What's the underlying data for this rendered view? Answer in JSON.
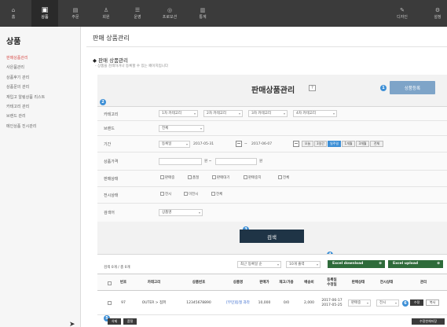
{
  "nav": {
    "left": [
      {
        "icon": "⌂",
        "label": "홈"
      },
      {
        "icon": "▣",
        "label": "상품"
      },
      {
        "icon": "▤",
        "label": "주문"
      },
      {
        "icon": "♙",
        "label": "회원"
      },
      {
        "icon": "☰",
        "label": "운영"
      },
      {
        "icon": "◎",
        "label": "프로모션"
      },
      {
        "icon": "▥",
        "label": "통계"
      }
    ],
    "right": [
      {
        "icon": "✎",
        "label": "디자인"
      },
      {
        "icon": "⚙",
        "label": "설정"
      }
    ]
  },
  "sidebar": {
    "title": "상품",
    "items": [
      {
        "label": "판매상품관리",
        "active": true
      },
      {
        "label": "사은품관리"
      },
      {
        "label": "상품후기 관리"
      },
      {
        "label": "상품문의 관리"
      },
      {
        "label": "재입고 알림상품 리스트"
      },
      {
        "label": "카테고리 관리"
      },
      {
        "label": "브랜드 관리"
      },
      {
        "label": "메인상품 진시관리"
      }
    ]
  },
  "page": {
    "title": "판매 상품관리",
    "section_title": "◆ 판매 상품관리",
    "section_sub": "- 상품을 검색하거나 등록할 수 있는 페이지입니다"
  },
  "panel": {
    "title": "판매상품관리",
    "title_icon": "?",
    "register_label": "상품등록",
    "badges": [
      "2",
      "1",
      "3",
      "4",
      "5",
      "6"
    ]
  },
  "form": {
    "category": {
      "label": "카테고리",
      "selects": [
        "1차 카테고리",
        "2차 카테고리",
        "3차 카테고리",
        "4차 카테고리"
      ]
    },
    "brand": {
      "label": "브랜드",
      "value": "전체"
    },
    "period": {
      "label": "기간",
      "type": "등록일",
      "from": "2017-05-31",
      "sep": "~",
      "to": "2017-06-07",
      "quick": [
        {
          "label": "오늘"
        },
        {
          "label": "3일간"
        },
        {
          "label": "일주일",
          "active": true
        },
        {
          "label": "1개월"
        },
        {
          "label": "3개월"
        },
        {
          "label": "전체"
        }
      ]
    },
    "price": {
      "label": "상품가격",
      "unit1": "원 ~",
      "unit2": "원"
    },
    "sale_status": {
      "label": "판매상태",
      "options": [
        "판매중",
        "품절",
        "판매대기",
        "판매중지",
        "전체"
      ]
    },
    "display_status": {
      "label": "전시상태",
      "options": [
        "전시",
        "미전시",
        "전체"
      ]
    },
    "keyword": {
      "label": "검색어",
      "type": "상품명"
    }
  },
  "search_label": "검색",
  "list": {
    "count": "검색 0개 / 총 0개",
    "sort": "최근 등록일 순",
    "page_size": "10개 출력",
    "excel_download": "Excel download",
    "excel_upload": "Excel upload",
    "plus": "⊕",
    "headers": [
      "번호",
      "카테고리",
      "상품번호",
      "상품명",
      "판매가",
      "재고/가용",
      "배송비",
      "등록일\n수정일",
      "판매상태",
      "전시상태",
      "관리"
    ],
    "rows": [
      {
        "no": "97",
        "category": "OUTER > 점퍼",
        "product_no": "12345678890",
        "name": "[무민]동절 과라",
        "price": "10,000",
        "stock": "0/0",
        "shipping": "2,000",
        "reg_date": "2017-06-17",
        "mod_date": "2017-05-25",
        "sale_status": "판매중",
        "display_status": "전시",
        "edit": "수정",
        "copy": "복사"
      }
    ],
    "delete_label": "삭제",
    "hold_label": "품절",
    "bulk_label": "수정한체저장"
  }
}
